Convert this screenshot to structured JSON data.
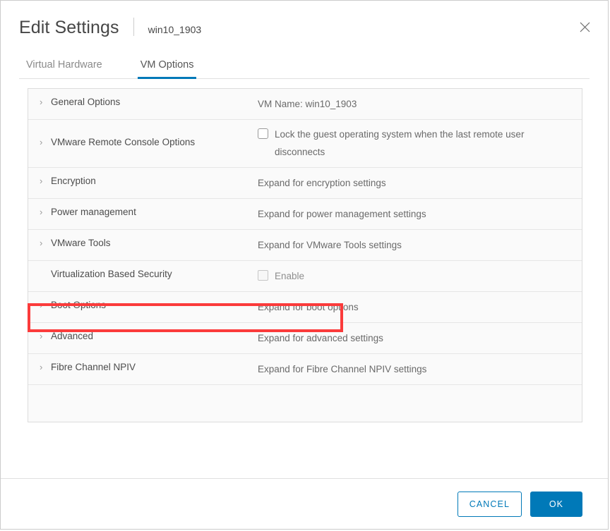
{
  "dialog": {
    "title": "Edit Settings",
    "subtitle": "win10_1903",
    "close_label": "×"
  },
  "tabs": [
    {
      "label": "Virtual Hardware",
      "active": false
    },
    {
      "label": "VM Options",
      "active": true
    }
  ],
  "settings_rows": [
    {
      "label": "General Options",
      "value": "VM Name: win10_1903",
      "has_chevron": true,
      "type": "text"
    },
    {
      "label": "VMware Remote Console Options",
      "value": "Lock the guest operating system when the last remote user disconnects",
      "has_chevron": true,
      "type": "checkbox",
      "checked": false,
      "disabled": false
    },
    {
      "label": "Encryption",
      "value": "Expand for encryption settings",
      "has_chevron": true,
      "type": "text"
    },
    {
      "label": "Power management",
      "value": "Expand for power management settings",
      "has_chevron": true,
      "type": "text"
    },
    {
      "label": "VMware Tools",
      "value": "Expand for VMware Tools settings",
      "has_chevron": true,
      "type": "text"
    },
    {
      "label": "Virtualization Based Security",
      "value": "Enable",
      "has_chevron": false,
      "type": "checkbox",
      "checked": false,
      "disabled": true,
      "highlighted": true
    },
    {
      "label": "Boot Options",
      "value": "Expand for boot options",
      "has_chevron": true,
      "type": "text"
    },
    {
      "label": "Advanced",
      "value": "Expand for advanced settings",
      "has_chevron": true,
      "type": "text"
    },
    {
      "label": "Fibre Channel NPIV",
      "value": "Expand for Fibre Channel NPIV settings",
      "has_chevron": true,
      "type": "text"
    }
  ],
  "footer": {
    "cancel_label": "CANCEL",
    "ok_label": "OK"
  },
  "colors": {
    "accent": "#0079b8",
    "highlight": "#fb3b3b",
    "panel_bg": "#fafafa",
    "text": "#565656"
  },
  "chevron_glyph": "›"
}
